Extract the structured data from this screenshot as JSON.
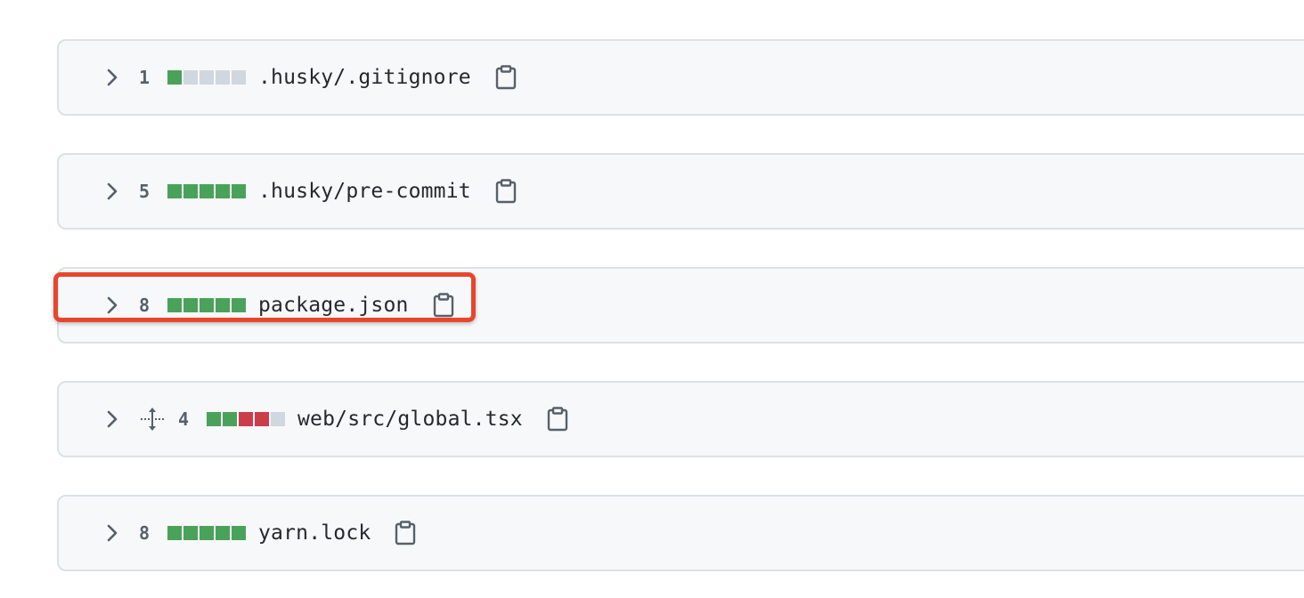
{
  "accent": {
    "added": "#4aa25a",
    "removed": "#cc3d4b",
    "neutral": "#d0d7de",
    "highlight": "#e8452c"
  },
  "files": [
    {
      "count": "1",
      "path": ".husky/.gitignore",
      "blocks": [
        "g",
        "n",
        "n",
        "n",
        "n"
      ],
      "moved": false,
      "expand_icon": "chevron-right-icon",
      "copy_icon": "clipboard-icon"
    },
    {
      "count": "5",
      "path": ".husky/pre-commit",
      "blocks": [
        "g",
        "g",
        "g",
        "g",
        "g"
      ],
      "moved": false,
      "expand_icon": "chevron-right-icon",
      "copy_icon": "clipboard-icon"
    },
    {
      "count": "8",
      "path": "package.json",
      "blocks": [
        "g",
        "g",
        "g",
        "g",
        "g"
      ],
      "moved": false,
      "highlighted": true,
      "expand_icon": "chevron-right-icon",
      "copy_icon": "clipboard-icon"
    },
    {
      "count": "4",
      "path": "web/src/global.tsx",
      "blocks": [
        "g",
        "g",
        "r",
        "r",
        "n"
      ],
      "moved": true,
      "expand_icon": "chevron-right-icon",
      "move_icon": "move-icon",
      "copy_icon": "clipboard-icon"
    },
    {
      "count": "8",
      "path": "yarn.lock",
      "blocks": [
        "g",
        "g",
        "g",
        "g",
        "g"
      ],
      "moved": false,
      "expand_icon": "chevron-right-icon",
      "copy_icon": "clipboard-icon"
    }
  ]
}
